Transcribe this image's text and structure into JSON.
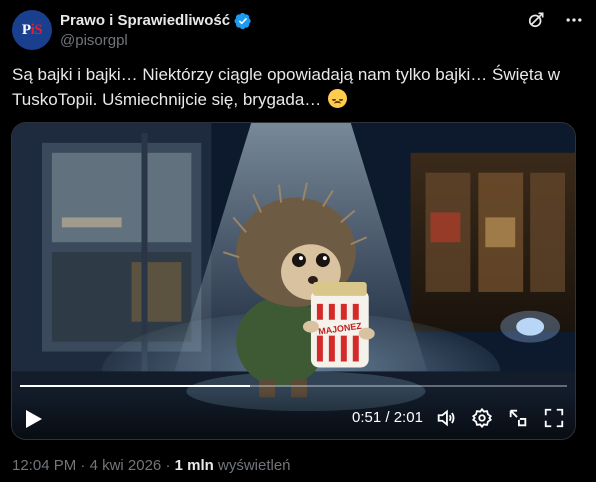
{
  "author": {
    "display_name": "Prawo i Sprawiedliwość",
    "handle": "@pisorgpl",
    "avatar_text_main": "P",
    "avatar_text_accent": "iS",
    "verified": true
  },
  "tweet": {
    "text": "Są bajki i bajki… Niektórzy ciągle opowiadają nam tylko bajki… Święta w TuskoTopii. Uśmiechnijcie się, brygada…"
  },
  "video": {
    "jar_label": "MAJONEZ",
    "current_time": "0:51",
    "separator": " / ",
    "duration": "2:01",
    "progress": 0.42
  },
  "meta": {
    "time": "12:04 PM",
    "dot": " · ",
    "date": "4 kwi 2026",
    "views_count": "1 mln",
    "views_label": " wyświetleń"
  },
  "icons": [
    "verified-badge-icon",
    "grok-icon",
    "more-icon",
    "play-icon",
    "volume-icon",
    "settings-gear-icon",
    "pip-icon",
    "fullscreen-icon"
  ]
}
